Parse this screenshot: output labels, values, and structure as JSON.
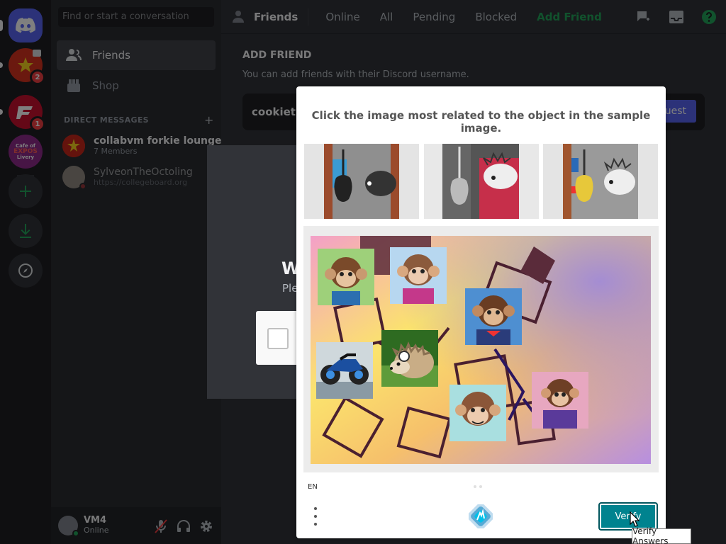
{
  "sidebar": {
    "search_placeholder": "Find or start a conversation",
    "nav": [
      {
        "label": "Friends",
        "icon": "friends-icon"
      },
      {
        "label": "Shop",
        "icon": "shop-icon"
      }
    ],
    "dm_header": "DIRECT MESSAGES",
    "dm_add": "+",
    "dms": [
      {
        "name": "collabvm forkie lounge",
        "sub": "7 Members"
      },
      {
        "name": "SylveonTheOctoling",
        "sub": "https://collegeboard.org"
      }
    ],
    "badges": [
      "2",
      "1"
    ],
    "server_label": [
      "Cafe of",
      "EXPOS",
      "Livery"
    ]
  },
  "user": {
    "name": "VM4",
    "status": "Online"
  },
  "topbar": {
    "title": "Friends",
    "tabs": [
      "Online",
      "All",
      "Pending",
      "Blocked"
    ],
    "add_friend": "Add Friend"
  },
  "add_friend": {
    "heading": "ADD FRIEND",
    "description": "You can add friends with their Discord username.",
    "input_value": "cookieth",
    "send_label": "uest"
  },
  "background_modal": {
    "title": "W",
    "text": "Ple"
  },
  "captcha": {
    "prompt": "Click the image most related to the object in the sample image.",
    "language": "EN",
    "verify_label": "Verify",
    "tooltip": "Verify Answers"
  },
  "colors": {
    "discord_blurple": "#5865f2",
    "online_green": "#23a55a",
    "verify_teal": "#00838f"
  }
}
